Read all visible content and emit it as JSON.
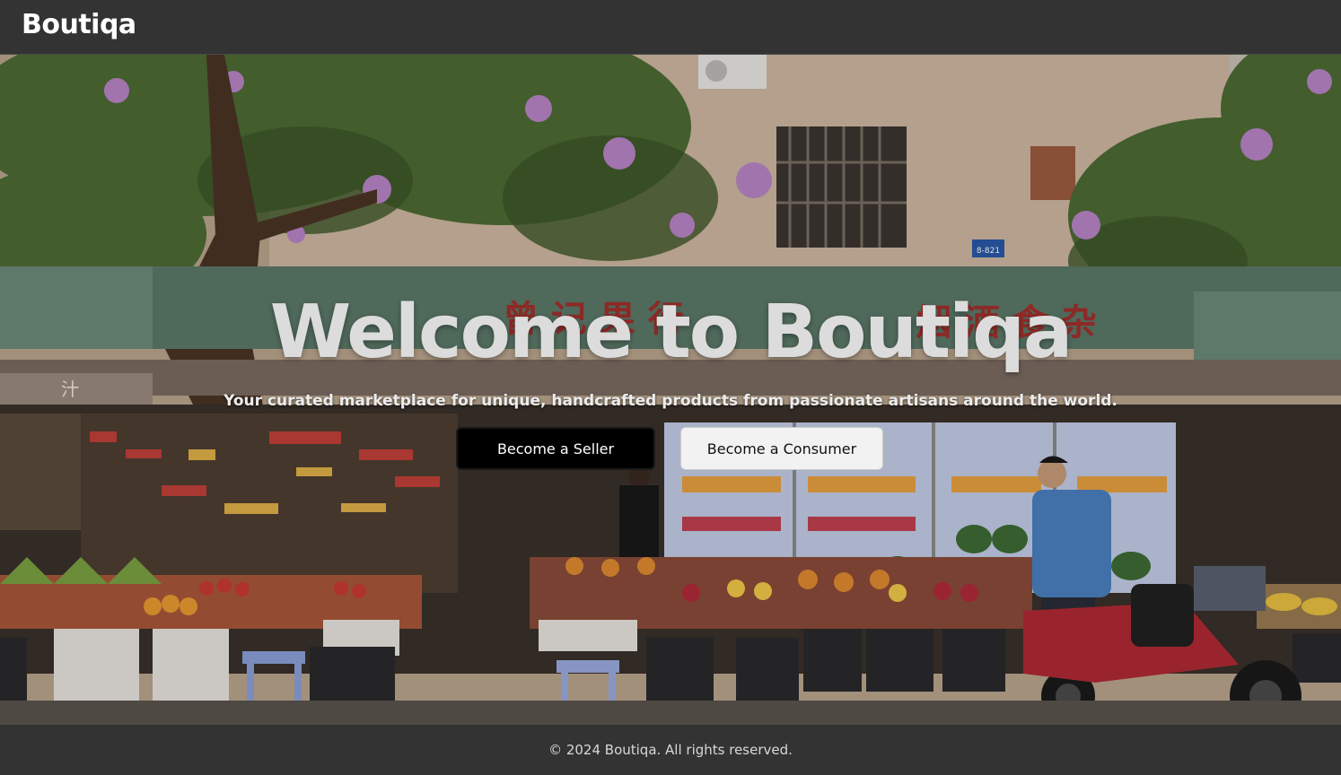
{
  "header": {
    "logo": "Boutiqa"
  },
  "hero": {
    "title": "Welcome to Boutiqa",
    "subtitle": "Your curated marketplace for unique, handcrafted products from passionate artisans around the world.",
    "buttons": {
      "seller_label": "Become a Seller",
      "consumer_label": "Become a Consumer"
    },
    "image": {
      "description_icon": "street-market-photo",
      "shop_sign_chars_left": "曾 记 果 行",
      "shop_sign_chars_right": "烟 酒 食 杂",
      "small_sign": "汁",
      "plate": "8-821"
    }
  },
  "footer": {
    "copyright": "© 2024 Boutiqa. All rights reserved."
  },
  "colors": {
    "header_bg": "#333333",
    "footer_bg": "#333333",
    "seller_button_bg": "#000000",
    "consumer_button_bg": "#f2f2f2"
  }
}
